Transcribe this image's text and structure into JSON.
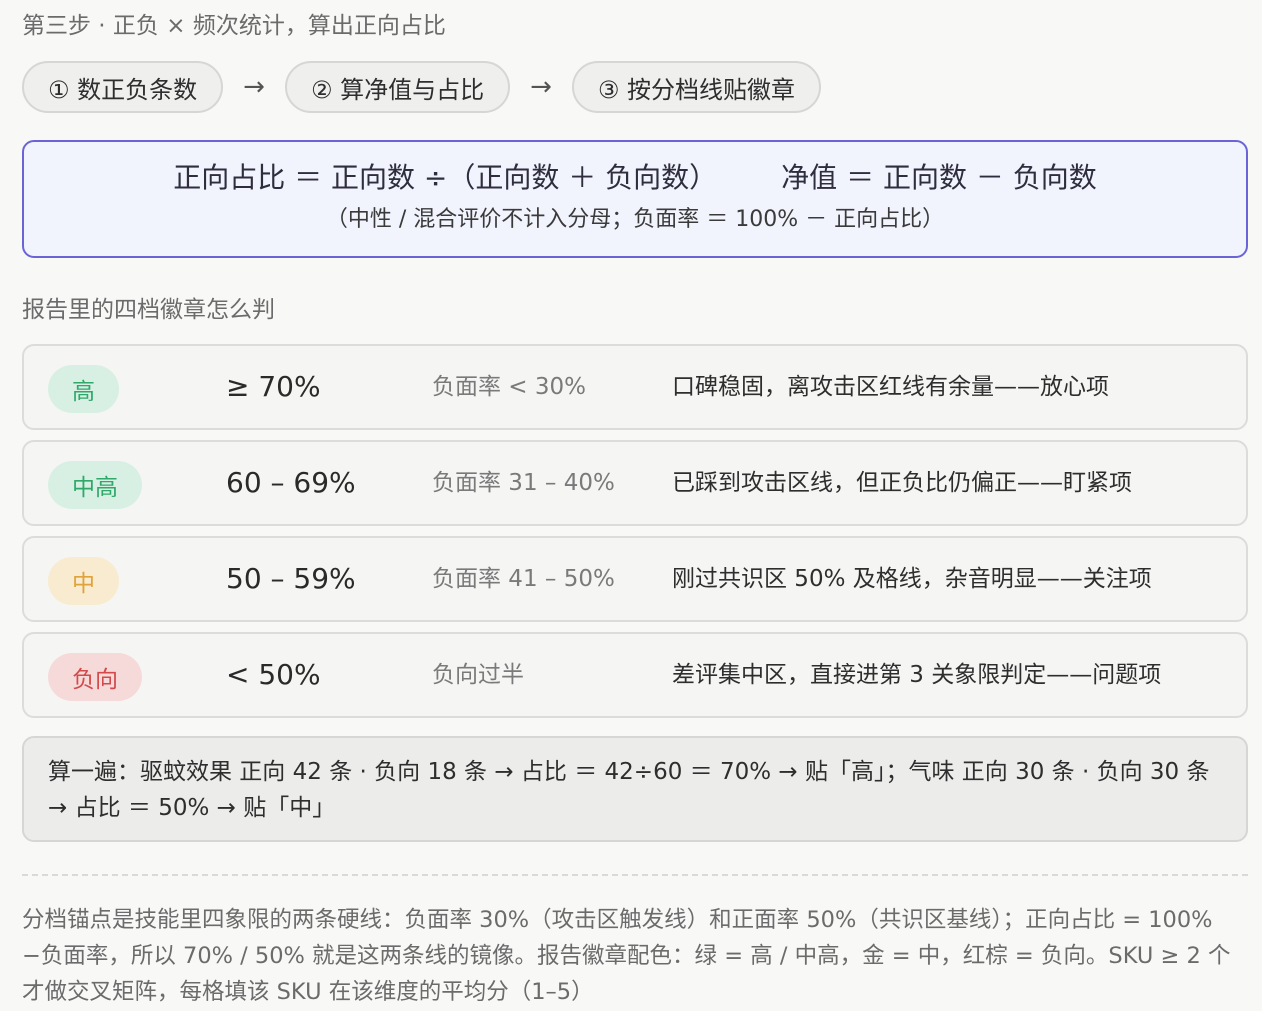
{
  "step_title": "第三步 · 正负 × 频次统计，算出正向占比",
  "steps": [
    {
      "label": "① 数正负条数"
    },
    {
      "label": "② 算净值与占比"
    },
    {
      "label": "③ 按分档线贴徽章"
    }
  ],
  "step_arrow": "→",
  "formula": {
    "main_left": "正向占比 ＝ 正向数 ÷（正向数 ＋ 负向数）",
    "main_right": "净值 ＝ 正向数 － 负向数",
    "sub": "（中性 / 混合评价不计入分母；负面率 ＝ 100% － 正向占比）"
  },
  "section_title": "报告里的四档徽章怎么判",
  "tiers": [
    {
      "badge": "高",
      "range": "≥ 70%",
      "neg": "负面率 < 30%",
      "desc": "口碑稳固，离攻击区红线有余量——放心项",
      "color": "green"
    },
    {
      "badge": "中高",
      "range": "60 – 69%",
      "neg": "负面率 31 – 40%",
      "desc": "已踩到攻击区线，但正负比仍偏正——盯紧项",
      "color": "green"
    },
    {
      "badge": "中",
      "range": "50 – 59%",
      "neg": "负面率 41 – 50%",
      "desc": "刚过共识区 50% 及格线，杂音明显——关注项",
      "color": "gold"
    },
    {
      "badge": "负向",
      "range": "< 50%",
      "neg": "负向过半",
      "desc": "差评集中区，直接进第 3 关象限判定——问题项",
      "color": "red"
    }
  ],
  "example": "算一遍：驱蚊效果 正向 42 条 · 负向 18 条 → 占比 ＝ 42÷60 ＝ 70% → 贴「高」；气味 正向 30 条 · 负向 30 条 → 占比 ＝ 50% → 贴「中」",
  "footnote": "分档锚点是技能里四象限的两条硬线：负面率 30%（攻击区触发线）和正面率 50%（共识区基线）；正向占比 = 100%−负面率，所以 70% / 50% 就是这两条线的镜像。报告徽章配色：绿 = 高 / 中高，金 = 中，红棕 = 负向。SKU ≥ 2 个才做交叉矩阵，每格填该 SKU 在该维度的平均分（1–5）",
  "colors": {
    "accent": "#6a64d8",
    "green": "#2fa86a",
    "gold": "#e0a23a",
    "red": "#d24a4a"
  }
}
